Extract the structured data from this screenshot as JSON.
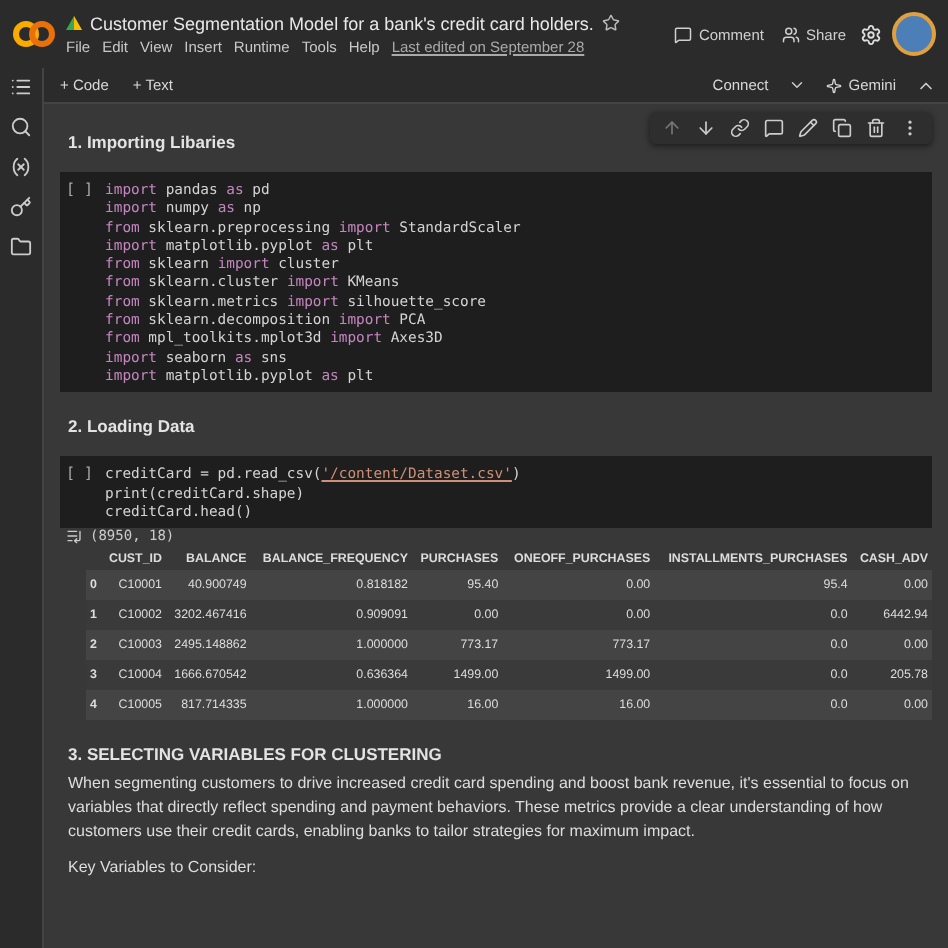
{
  "header": {
    "title": "Customer Segmentation Model for a bank's credit card holders.",
    "starred": false,
    "menu": [
      "File",
      "Edit",
      "View",
      "Insert",
      "Runtime",
      "Tools",
      "Help"
    ],
    "last_edited": "Last edited on September 28",
    "comment": "Comment",
    "share": "Share"
  },
  "toolbar": {
    "add": [
      "+ Code",
      "+ Text"
    ],
    "connect": "Connect",
    "gemini": "Gemini"
  },
  "cells": [
    {
      "kind": "text",
      "heading": "1. Importing Libaries"
    },
    {
      "kind": "code",
      "prompt": "[ ]",
      "lines": [
        [
          {
            "kind": "kw",
            "text": "import"
          },
          {
            "kind": "plain",
            "text": " pandas "
          },
          {
            "kind": "kw",
            "text": "as"
          },
          {
            "kind": "plain",
            "text": " pd"
          }
        ],
        [
          {
            "kind": "kw",
            "text": "import"
          },
          {
            "kind": "plain",
            "text": " numpy "
          },
          {
            "kind": "kw",
            "text": "as"
          },
          {
            "kind": "plain",
            "text": " np"
          }
        ],
        [
          {
            "kind": "kw",
            "text": "from"
          },
          {
            "kind": "plain",
            "text": " sklearn.preprocessing "
          },
          {
            "kind": "kw",
            "text": "import"
          },
          {
            "kind": "plain",
            "text": " StandardScaler"
          }
        ],
        [
          {
            "kind": "kw",
            "text": "import"
          },
          {
            "kind": "plain",
            "text": " matplotlib.pyplot "
          },
          {
            "kind": "kw",
            "text": "as"
          },
          {
            "kind": "plain",
            "text": " plt"
          }
        ],
        [
          {
            "kind": "kw",
            "text": "from"
          },
          {
            "kind": "plain",
            "text": " sklearn "
          },
          {
            "kind": "kw",
            "text": "import"
          },
          {
            "kind": "plain",
            "text": " cluster"
          }
        ],
        [
          {
            "kind": "kw",
            "text": "from"
          },
          {
            "kind": "plain",
            "text": " sklearn.cluster "
          },
          {
            "kind": "kw",
            "text": "import"
          },
          {
            "kind": "plain",
            "text": " KMeans"
          }
        ],
        [
          {
            "kind": "kw",
            "text": "from"
          },
          {
            "kind": "plain",
            "text": " sklearn.metrics "
          },
          {
            "kind": "kw",
            "text": "import"
          },
          {
            "kind": "plain",
            "text": " silhouette_score"
          }
        ],
        [
          {
            "kind": "kw",
            "text": "from"
          },
          {
            "kind": "plain",
            "text": " sklearn.decomposition "
          },
          {
            "kind": "kw",
            "text": "import"
          },
          {
            "kind": "plain",
            "text": " PCA"
          }
        ],
        [
          {
            "kind": "kw",
            "text": "from"
          },
          {
            "kind": "plain",
            "text": " mpl_toolkits.mplot3d "
          },
          {
            "kind": "kw",
            "text": "import"
          },
          {
            "kind": "plain",
            "text": " Axes3D"
          }
        ],
        [
          {
            "kind": "kw",
            "text": "import"
          },
          {
            "kind": "plain",
            "text": " seaborn "
          },
          {
            "kind": "kw",
            "text": "as"
          },
          {
            "kind": "plain",
            "text": " sns"
          }
        ],
        [
          {
            "kind": "kw",
            "text": "import"
          },
          {
            "kind": "plain",
            "text": " matplotlib.pyplot "
          },
          {
            "kind": "kw",
            "text": "as"
          },
          {
            "kind": "plain",
            "text": " plt"
          }
        ]
      ]
    },
    {
      "kind": "text",
      "heading": "2. Loading Data"
    },
    {
      "kind": "code",
      "prompt": "[ ]",
      "lines": [
        [
          {
            "kind": "plain",
            "text": "creditCard = pd.read_csv("
          },
          {
            "kind": "str",
            "text": "'/content/Dataset.csv'"
          },
          {
            "kind": "plain",
            "text": ")"
          }
        ],
        [
          {
            "kind": "plain",
            "text": "print(creditCard.shape)"
          }
        ],
        [
          {
            "kind": "plain",
            "text": "creditCard.head()"
          }
        ]
      ],
      "output": {
        "text": "(8950, 18)",
        "columns": [
          "",
          "CUST_ID",
          "BALANCE",
          "BALANCE_FREQUENCY",
          "PURCHASES",
          "ONEOFF_PURCHASES",
          "INSTALLMENTS_PURCHASES",
          "CASH_ADV"
        ],
        "rows": [
          [
            "0",
            "C10001",
            "40.900749",
            "0.818182",
            "95.40",
            "0.00",
            "95.4",
            "0.00"
          ],
          [
            "1",
            "C10002",
            "3202.467416",
            "0.909091",
            "0.00",
            "0.00",
            "0.0",
            "6442.94"
          ],
          [
            "2",
            "C10003",
            "2495.148862",
            "1.000000",
            "773.17",
            "773.17",
            "0.0",
            "0.00"
          ],
          [
            "3",
            "C10004",
            "1666.670542",
            "0.636364",
            "1499.00",
            "1499.00",
            "0.0",
            "205.78"
          ],
          [
            "4",
            "C10005",
            "817.714335",
            "1.000000",
            "16.00",
            "16.00",
            "0.0",
            "0.00"
          ]
        ]
      }
    },
    {
      "kind": "text",
      "heading": "3. SELECTING VARIABLES FOR CLUSTERING",
      "paragraphs": [
        "When segmenting customers to drive increased credit card spending and boost bank revenue, it's essential to focus on variables that directly reflect spending and payment behaviors. These metrics provide a clear understanding of how customers use their credit cards, enabling banks to tailor strategies for maximum impact.",
        "Key Variables to Consider:"
      ]
    }
  ]
}
